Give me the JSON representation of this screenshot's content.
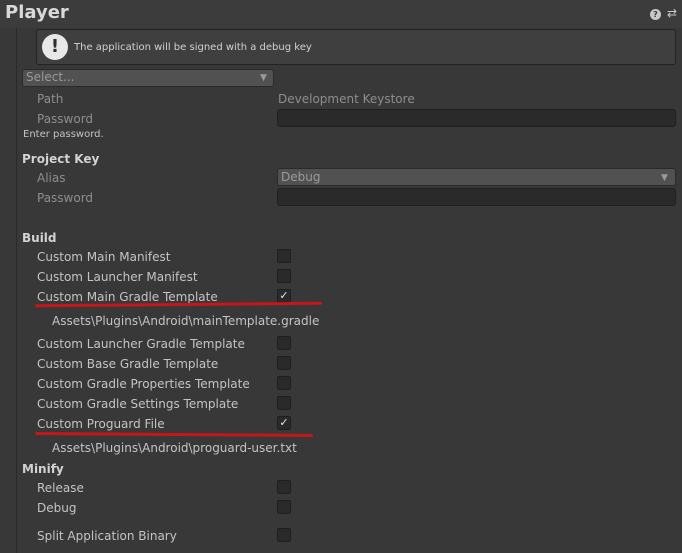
{
  "header": {
    "title": "Player",
    "help_glyph": "?",
    "settings_glyph": "⇄"
  },
  "helpbox": {
    "icon_glyph": "!",
    "text": "The application will be signed with a debug key"
  },
  "keystore": {
    "select_placeholder": "Select...",
    "path_label": "Path",
    "path_value": "Development Keystore",
    "password_label": "Password",
    "password_value": "",
    "hint": "Enter password."
  },
  "project_key": {
    "heading": "Project Key",
    "alias_label": "Alias",
    "alias_value": "Debug",
    "password_label": "Password",
    "password_value": ""
  },
  "build": {
    "heading": "Build",
    "items": [
      {
        "label": "Custom Main Manifest",
        "checked": false
      },
      {
        "label": "Custom Launcher Manifest",
        "checked": false
      },
      {
        "label": "Custom Main Gradle Template",
        "checked": true,
        "path": "Assets\\Plugins\\Android\\mainTemplate.gradle"
      },
      {
        "label": "Custom Launcher Gradle Template",
        "checked": false
      },
      {
        "label": "Custom Base Gradle Template",
        "checked": false
      },
      {
        "label": "Custom Gradle Properties Template",
        "checked": false
      },
      {
        "label": "Custom Gradle Settings Template",
        "checked": false
      },
      {
        "label": "Custom Proguard File",
        "checked": true,
        "path": "Assets\\Plugins\\Android\\proguard-user.txt"
      }
    ]
  },
  "minify": {
    "heading": "Minify",
    "items": [
      {
        "label": "Release",
        "checked": false
      },
      {
        "label": "Debug",
        "checked": false
      }
    ]
  },
  "split_binary": {
    "label": "Split Application Binary",
    "checked": false
  },
  "glyphs": {
    "check": "✓",
    "arrow": "▼"
  },
  "colors": {
    "annotation_red": "#c5161c",
    "background": "#383838"
  }
}
